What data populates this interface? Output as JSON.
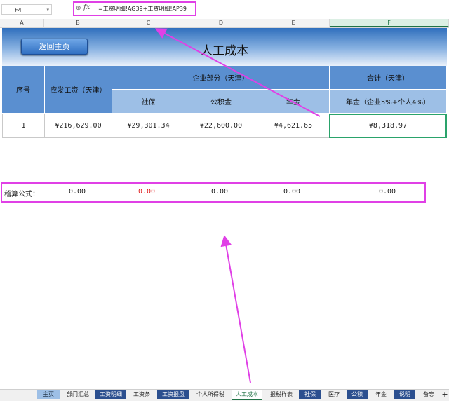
{
  "formula_bar": {
    "name_box": "F4",
    "fx_label": "fx",
    "formula": "=工资明细!AG39+工资明细!AP39"
  },
  "columns": [
    "A",
    "B",
    "C",
    "D",
    "E",
    "F"
  ],
  "banner": {
    "home_button": "返回主页",
    "title": "人工成本"
  },
  "table": {
    "h_seq": "序号",
    "h_gross": "应发工资（天津）",
    "h_company": "企业部分（天津）",
    "h_total": "合计（天津）",
    "h_social": "社保",
    "h_fund": "公积金",
    "h_pension": "年金",
    "h_pension_total": "年金（企业5%+个人4%）",
    "row": {
      "seq": "1",
      "gross": "¥216,629.00",
      "social": "¥29,301.34",
      "fund": "¥22,600.00",
      "pension": "¥4,621.65",
      "total": "¥8,318.97"
    }
  },
  "check_row": {
    "label": "稽算公式：",
    "v1": "0.00",
    "v2": "0.00",
    "v3": "0.00",
    "v4": "0.00",
    "v5": "0.00",
    "red_color": "#e02020"
  },
  "sheet_tabs": [
    "主页",
    "部门汇总",
    "工资明细",
    "工资条",
    "工资报盘",
    "个人所得税",
    "人工成本",
    "报税样表",
    "社保",
    "医疗",
    "公积",
    "年金",
    "说明",
    "备忘"
  ],
  "active_tab": "人工成本",
  "colors": {
    "annotation": "#e040e6",
    "header_blue": "#5a8fd0",
    "selection_green": "#2aa36b"
  }
}
